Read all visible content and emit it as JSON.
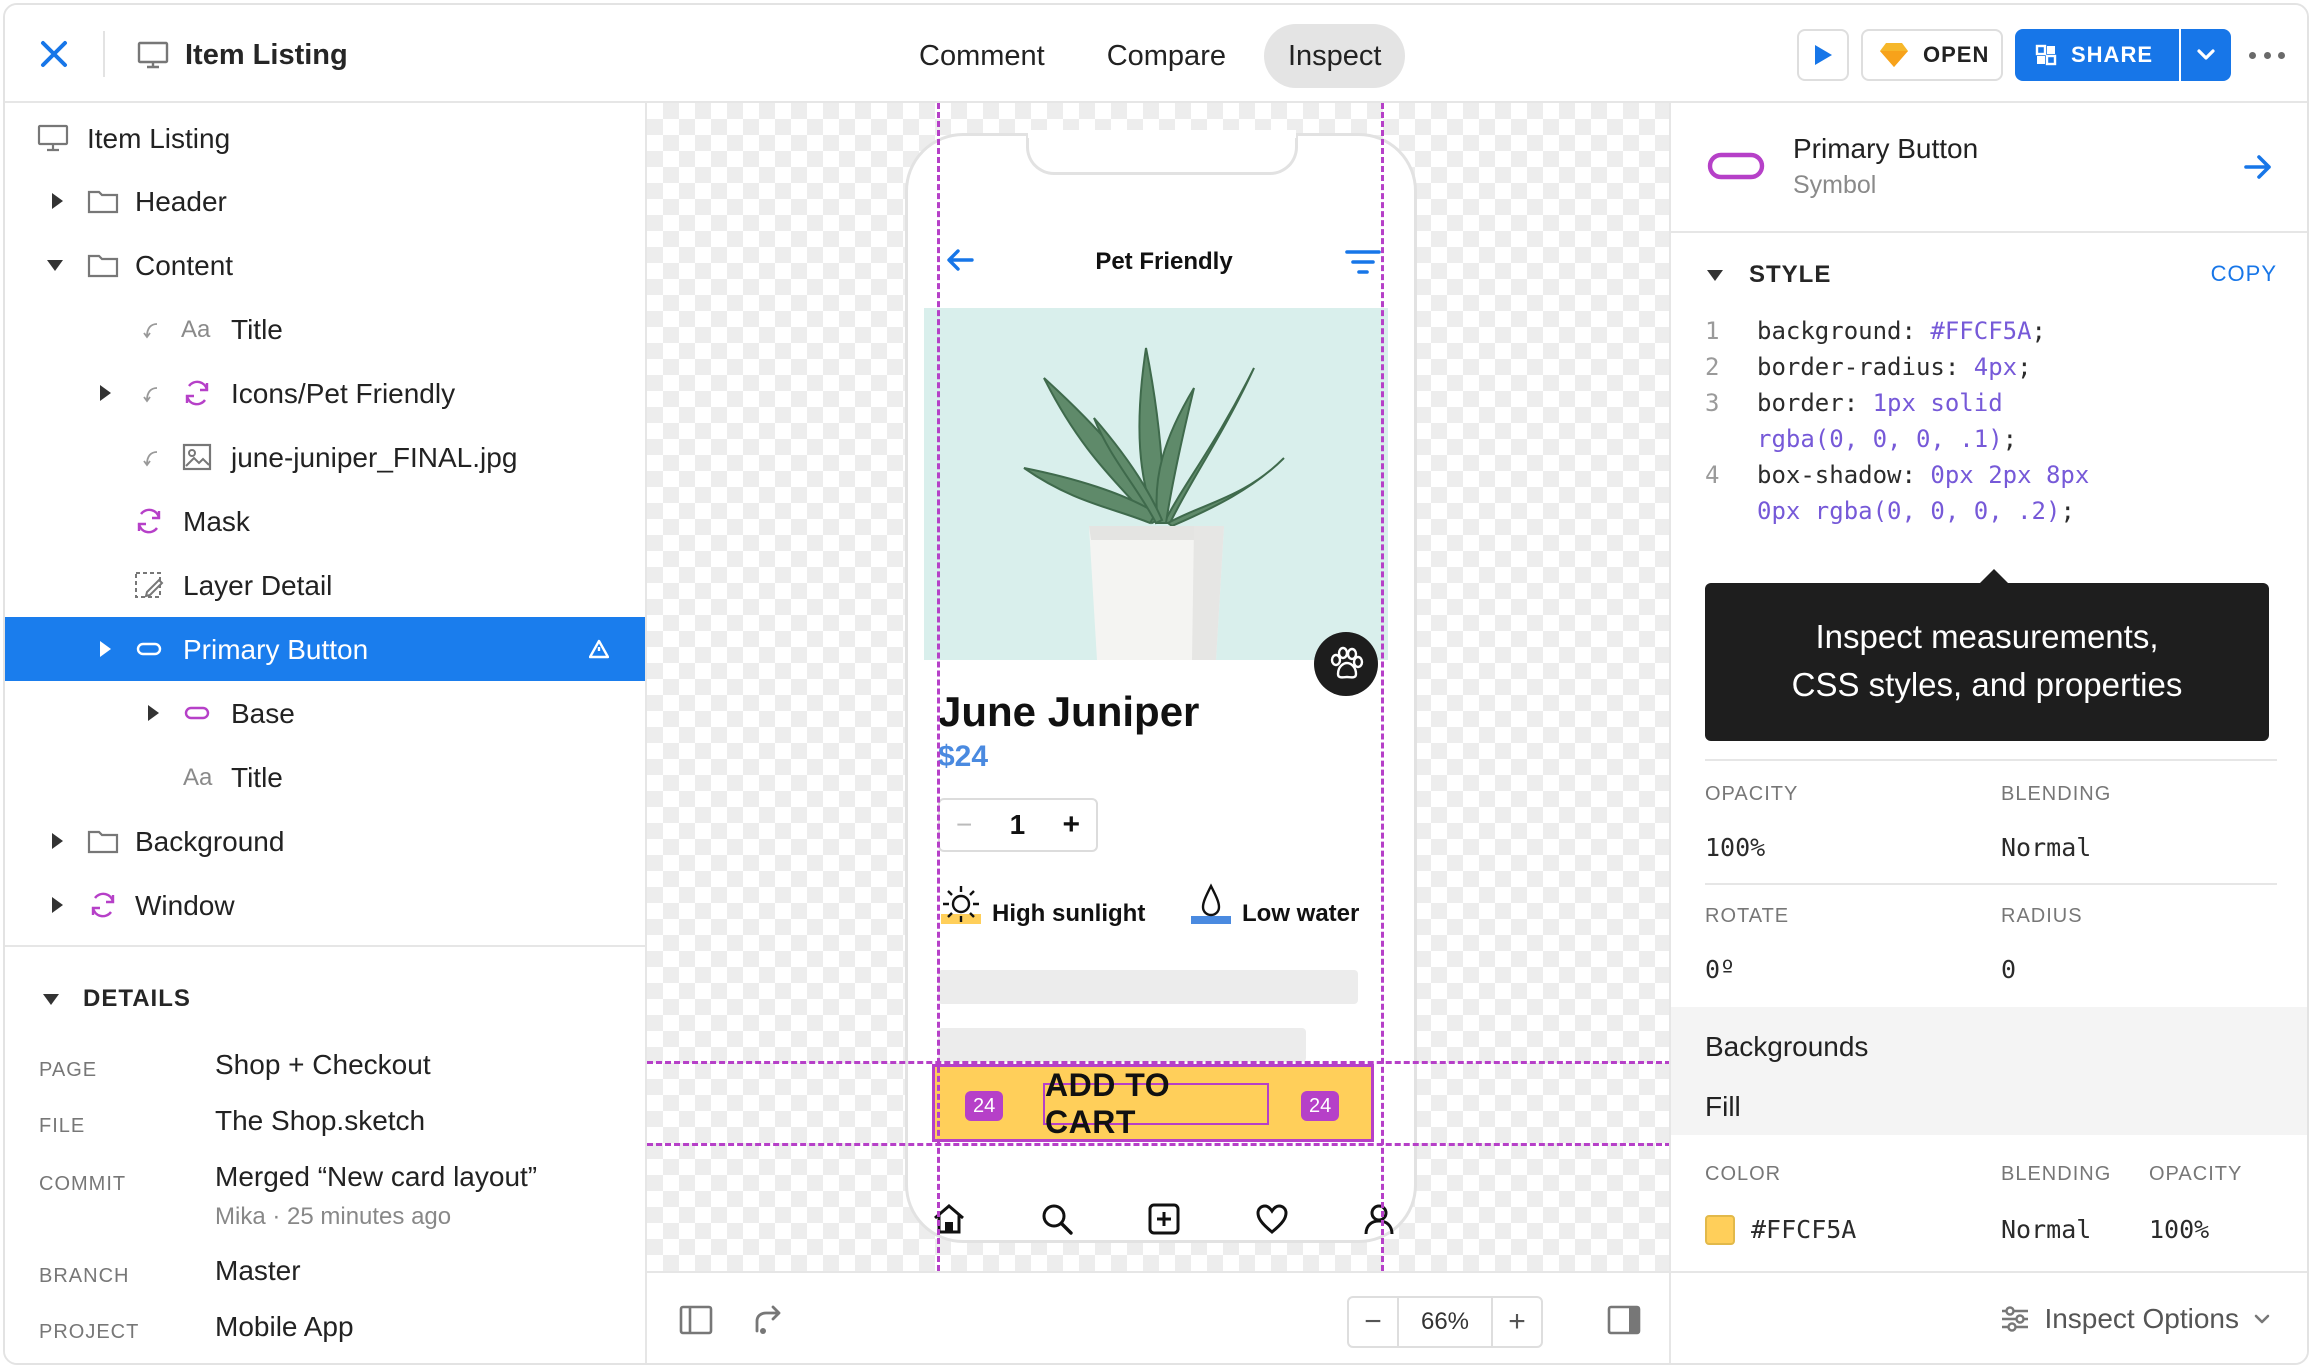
{
  "topbar": {
    "doc_title": "Item Listing",
    "modes": [
      "Comment",
      "Compare",
      "Inspect"
    ],
    "active_mode": "Inspect",
    "open_label": "OPEN",
    "share_label": "SHARE"
  },
  "layers": {
    "root": "Item Listing",
    "header": "Header",
    "content": "Content",
    "title": "Title",
    "icons_pet": "Icons/Pet Friendly",
    "image": "june-juniper_FINAL.jpg",
    "mask": "Mask",
    "layer_detail": "Layer Detail",
    "primary_button": "Primary Button",
    "base": "Base",
    "title2": "Title",
    "background": "Background",
    "window": "Window",
    "text_glyph": "Aa"
  },
  "details": {
    "heading": "DETAILS",
    "page_key": "PAGE",
    "page_val": "Shop + Checkout",
    "file_key": "FILE",
    "file_val": "The Shop.sketch",
    "commit_key": "COMMIT",
    "commit_val": "Merged “New card layout”",
    "commit_meta": "Mika · 25 minutes ago",
    "branch_key": "BRANCH",
    "branch_val": "Master",
    "project_key": "PROJECT",
    "project_val": "Mobile App"
  },
  "artboard": {
    "screen_title": "Pet Friendly",
    "product_name": "June Juniper",
    "price": "$24",
    "quantity": "1",
    "minus": "−",
    "plus": "+",
    "care1": "High sunlight",
    "care2": "Low water",
    "cta_label": "ADD TO CART",
    "spacing_left": "24",
    "spacing_right": "24",
    "cta_color": "#FFCF5A",
    "guide_color": "#B640C8"
  },
  "canvas_bar": {
    "zoom_minus": "−",
    "zoom_value": "66%",
    "zoom_plus": "+"
  },
  "inspector": {
    "symbol_name": "Primary Button",
    "symbol_type": "Symbol",
    "style_heading": "STYLE",
    "copy_label": "COPY",
    "code": [
      {
        "n": "1",
        "prop": "background: ",
        "val": "#FFCF5A",
        "end": ";"
      },
      {
        "n": "2",
        "prop": "border-radius: ",
        "val": "4px",
        "end": ";"
      },
      {
        "n": "3",
        "prop": "border: ",
        "val": "1px solid",
        "end": ""
      },
      {
        "n": "",
        "prop": "",
        "val": "rgba(0, 0, 0, .1)",
        "end": ";"
      },
      {
        "n": "4",
        "prop": "box-shadow: ",
        "val": "0px 2px 8px",
        "end": ""
      },
      {
        "n": "",
        "prop": "",
        "val": "0px rgba(0, 0, 0, .2)",
        "end": ";"
      }
    ],
    "tooltip_line1": "Inspect measurements,",
    "tooltip_line2": "CSS styles, and properties",
    "opacity_key": "OPACITY",
    "opacity_val": "100%",
    "blending_key": "BLENDING",
    "blending_val": "Normal",
    "rotate_key": "ROTATE",
    "rotate_val": "0º",
    "radius_key": "RADIUS",
    "radius_val": "0",
    "backgrounds_title": "Backgrounds",
    "fill_title": "Fill",
    "color_key": "COLOR",
    "color_blend_key": "BLENDING",
    "color_opacity_key": "OPACITY",
    "color_val": "#FFCF5A",
    "color_blend_val": "Normal",
    "color_opacity_val": "100%",
    "inspect_options": "Inspect Options"
  },
  "colors": {
    "accent": "#1776E8",
    "selected_row": "#1A7DED",
    "symbol_purple": "#B640C8",
    "tooltip_bg": "#1E1E1E"
  }
}
